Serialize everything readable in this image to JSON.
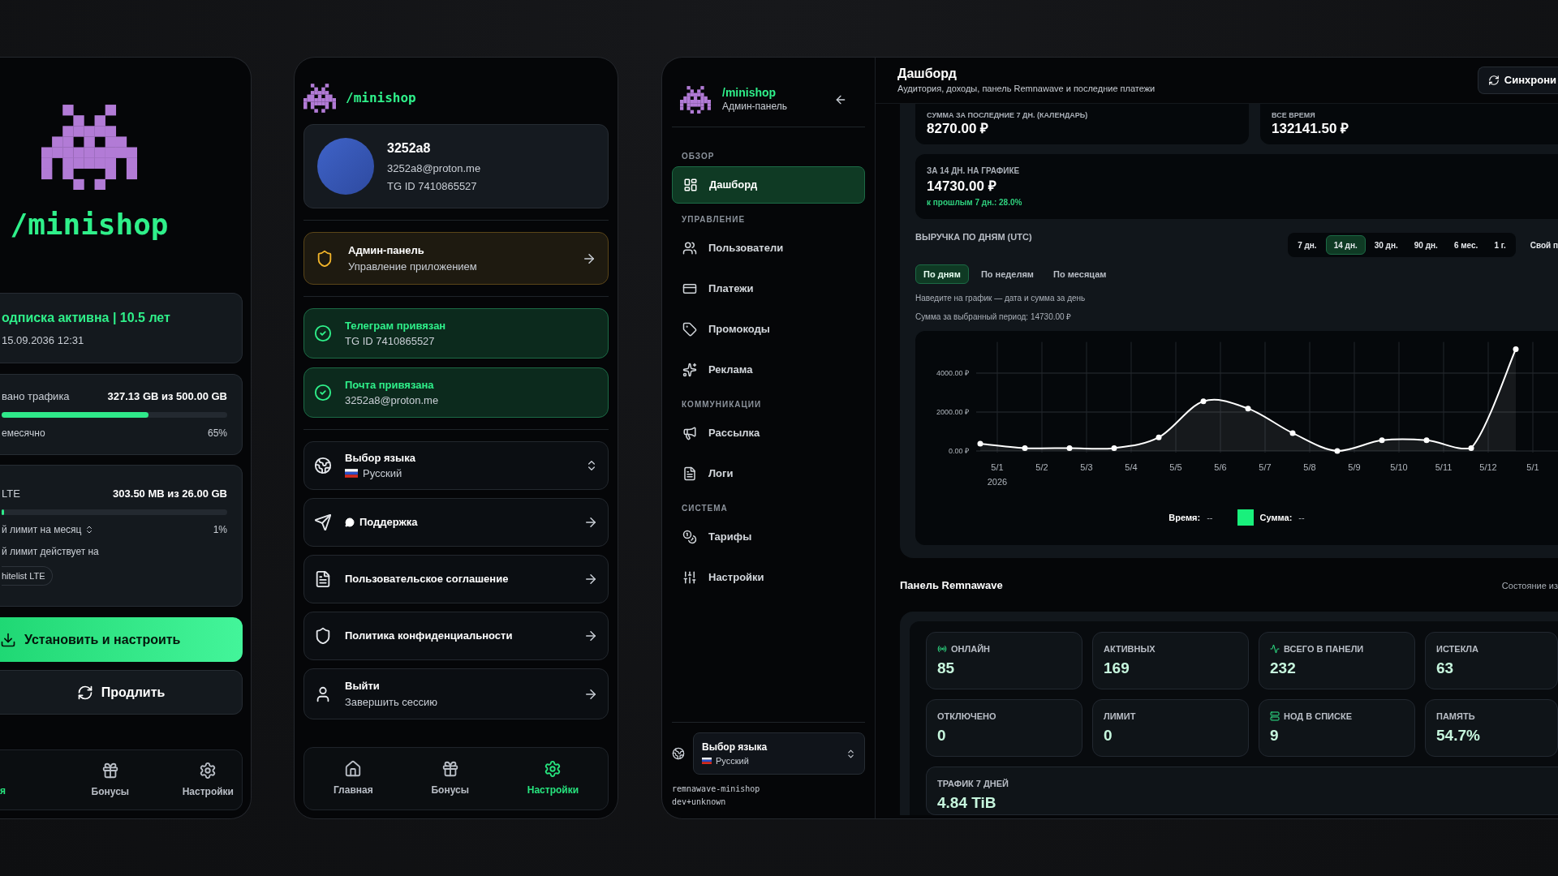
{
  "phone_home": {
    "logo_text": "/minishop",
    "subscription": {
      "status": "одписка активна | 10.5 лет",
      "until": "15.09.2036 12:31"
    },
    "traffic": {
      "label": "вано трафика",
      "value": "327.13 GB из 500.00 GB",
      "level": 0.65,
      "period": "емесячно",
      "percent": "65%"
    },
    "lte": {
      "label": "LTE",
      "value": "303.50 MB из 26.00 GB",
      "level": 0.01,
      "limit_select": "й лимит на месяц",
      "percent": "1%",
      "note": "й лимит действует на",
      "tag": "hitelist LTE"
    },
    "buttons": [
      {
        "kind": "primary",
        "label": "Установить и настроить"
      },
      {
        "kind": "secondary",
        "label": "Продлить"
      }
    ],
    "nav": [
      {
        "label": "я",
        "selected": true
      },
      {
        "kind": "bonus",
        "label": "Бонусы",
        "selected": false
      },
      {
        "kind": "settings",
        "label": "Настройки",
        "selected": false
      }
    ]
  },
  "phone_settings": {
    "logo_text": "/minishop",
    "profile": {
      "name": "3252a8",
      "email": "3252a8@proton.me",
      "tg": "TG ID 7410865527"
    },
    "admin_link": {
      "title": "Админ-панель",
      "subtitle": "Управление приложением"
    },
    "linked": [
      {
        "title": "Телеграм привязан",
        "detail": "TG ID 7410865527"
      },
      {
        "title": "Почта привязана",
        "detail": "3252a8@proton.me"
      }
    ],
    "menu": [
      {
        "kind": "language",
        "title": "Выбор языка",
        "value": "Русский"
      },
      {
        "kind": "support",
        "title": "Поддержка"
      },
      {
        "kind": "agreement",
        "title": "Пользовательское соглашение"
      },
      {
        "kind": "privacy",
        "title": "Политика конфиденциальности"
      },
      {
        "kind": "logout",
        "title": "Выйти",
        "subtitle": "Завершить сессию"
      }
    ],
    "nav": [
      {
        "kind": "home",
        "label": "Главная",
        "selected": false
      },
      {
        "kind": "bonus",
        "label": "Бонусы",
        "selected": false
      },
      {
        "kind": "settings",
        "label": "Настройки",
        "selected": true
      }
    ]
  },
  "admin": {
    "sidebar": {
      "logo_text": "/minishop",
      "subtitle": "Админ-панель",
      "sections": [
        {
          "title": "ОБЗОР",
          "items": [
            {
              "kind": "dashboard",
              "label": "Дашборд",
              "selected": true
            }
          ]
        },
        {
          "title": "УПРАВЛЕНИЕ",
          "items": [
            {
              "kind": "users",
              "label": "Пользователи",
              "selected": false
            },
            {
              "kind": "payments",
              "label": "Платежи",
              "selected": false
            },
            {
              "kind": "promo",
              "label": "Промокоды",
              "selected": false
            },
            {
              "kind": "ads",
              "label": "Реклама",
              "selected": false
            }
          ]
        },
        {
          "title": "КОММУНИКАЦИИ",
          "items": [
            {
              "kind": "mailing",
              "label": "Рассылка",
              "selected": false
            },
            {
              "kind": "logs",
              "label": "Логи",
              "selected": false
            }
          ]
        },
        {
          "title": "СИСТЕМА",
          "items": [
            {
              "kind": "tariffs",
              "label": "Тарифы",
              "selected": false
            },
            {
              "kind": "settings",
              "label": "Настройки",
              "selected": false
            }
          ]
        }
      ],
      "language": {
        "label": "Выбор языка",
        "value": "Русский"
      },
      "version": [
        "remnawave-minishop",
        "dev+unknown"
      ]
    },
    "header": {
      "title": "Дашборд",
      "subtitle": "Аудитория, доходы, панель Remnawave и последние платежи",
      "sync_button": "Синхрони"
    },
    "summary_cards": [
      {
        "label": "СУММА ЗА ПОСЛЕДНИЕ 7 ДН. (КАЛЕНДАРЬ)",
        "value": "8270.00 ₽"
      },
      {
        "label": "ВСЕ ВРЕМЯ",
        "value": "132141.50 ₽"
      }
    ],
    "period_card": {
      "label": "ЗА 14 ДН. НА ГРАФИКЕ",
      "value": "14730.00 ₽",
      "change": "к прошлым 7 дн.: 28.0%"
    },
    "revenue": {
      "title": "ВЫРУЧКА ПО ДНЯМ (UTC)",
      "ranges": [
        {
          "label": "7 дн.",
          "selected": false
        },
        {
          "label": "14 дн.",
          "selected": true
        },
        {
          "label": "30 дн.",
          "selected": false
        },
        {
          "label": "90 дн.",
          "selected": false
        },
        {
          "label": "6 мес.",
          "selected": false
        },
        {
          "label": "1 г.",
          "selected": false
        }
      ],
      "custom_range": "Свой п",
      "granularity": [
        {
          "label": "По дням",
          "selected": true
        },
        {
          "label": "По неделям",
          "selected": false
        },
        {
          "label": "По месяцам",
          "selected": false
        }
      ],
      "hint": "Наведите на график — дата и сумма за день",
      "total": "Сумма за выбранный период: 14730.00 ₽",
      "year": "2026",
      "chart_data": {
        "type": "area",
        "categories": [
          "5/1",
          "5/2",
          "5/3",
          "5/4",
          "5/5",
          "5/6",
          "5/7",
          "5/8",
          "5/9",
          "5/10",
          "5/11",
          "5/12",
          "5/1"
        ],
        "series": [
          {
            "color": "#ffffff",
            "values": [
              370,
              150,
              150,
              150,
              700,
              2550,
              2180,
              920,
              0,
              550,
              550,
              150,
              5230
            ]
          }
        ],
        "grid": true,
        "ylim": [
          0,
          5600
        ],
        "yticks": [
          {
            "value": 0,
            "label": "0.00 ₽"
          },
          {
            "value": 2000,
            "label": "2000.00 ₽"
          },
          {
            "value": 4000,
            "label": "4000.00 ₽"
          }
        ]
      },
      "legend": {
        "time_label": "Время:",
        "time_value": "--",
        "sum_label": "Сумма:",
        "sum_value": "--"
      }
    },
    "remnawave": {
      "title": "Панель Remnawave",
      "status": "Состояние из",
      "stats": [
        {
          "label": "ОНЛАЙН",
          "value": "85"
        },
        {
          "label": "АКТИВНЫХ",
          "value": "169"
        },
        {
          "label": "ВСЕГО В ПАНЕЛИ",
          "value": "232"
        },
        {
          "label": "ИСТЕКЛА",
          "value": "63"
        },
        {
          "label": "ОТКЛЮЧЕНО",
          "value": "0"
        },
        {
          "label": "ЛИМИТ",
          "value": "0"
        },
        {
          "label": "НОД В СПИСКЕ",
          "value": "9"
        },
        {
          "label": "ПАМЯТЬ",
          "value": "54.7%"
        }
      ],
      "traffic": {
        "label": "ТРАФИК 7 ДНЕЙ",
        "value": "4.84 TiB"
      }
    }
  }
}
